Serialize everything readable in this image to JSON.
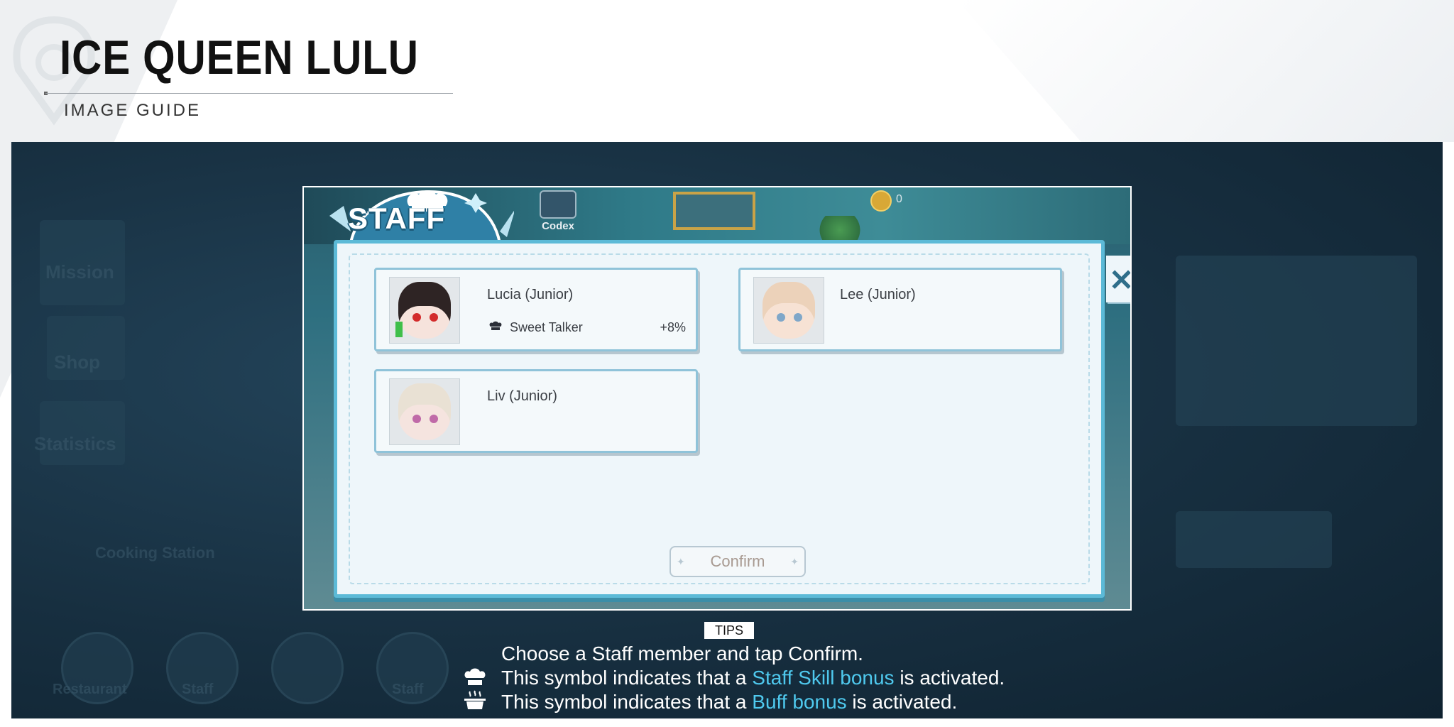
{
  "header": {
    "title": "ICE QUEEN LULU",
    "subtitle": "IMAGE GUIDE"
  },
  "background_menu": {
    "items": [
      "Mission",
      "Shop",
      "Statistics",
      "Cooking Station",
      "Restaurant",
      "Staff",
      "Staff"
    ]
  },
  "modal": {
    "banner": "STAFF",
    "codex_label": "Codex",
    "coin_count": "0",
    "close_symbol": "✕",
    "staff": [
      {
        "name": "Lucia (Junior)",
        "skill": "Sweet Talker",
        "bonus": "+8%"
      },
      {
        "name": "Lee (Junior)"
      },
      {
        "name": "Liv (Junior)"
      }
    ],
    "confirm_label": "Confirm"
  },
  "tips": {
    "badge": "TIPS",
    "line1": "Choose a Staff member and tap Confirm.",
    "line2_pre": "This symbol indicates that a ",
    "line2_hl": "Staff Skill bonus",
    "line2_post": " is activated.",
    "line3_pre": "This symbol indicates that a ",
    "line3_hl": "Buff bonus",
    "line3_post": " is activated."
  },
  "colors": {
    "panel_border": "#5cbad7",
    "highlight": "#4fc9ee",
    "game_bg": "#172f40"
  },
  "icons": [
    "chef-hat-icon",
    "cooking-pot-icon",
    "coin-icon",
    "close-icon",
    "sparkle-icon"
  ]
}
